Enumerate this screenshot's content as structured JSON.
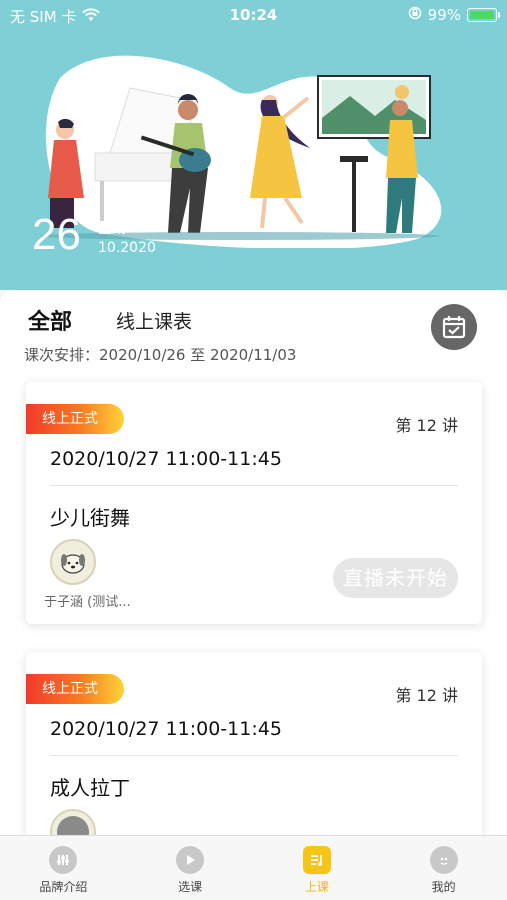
{
  "status_bar": {
    "carrier": "无 SIM 卡",
    "time": "10:24",
    "battery": "99%",
    "battery_level": 0.99
  },
  "banner": {
    "day": "26",
    "weekday": "星期一",
    "month_year": "10.2020"
  },
  "filter": {
    "tab_all": "全部",
    "tab_online": "线上课表",
    "schedule_text": "课次安排：2020/10/26 至 2020/11/03"
  },
  "courses": [
    {
      "badge": "线上正式",
      "lesson": "第 12 讲",
      "time": "2020/10/27 11:00-11:45",
      "title": "少儿街舞",
      "teacher": "于子涵 (测试...",
      "status": "直播未开始"
    },
    {
      "badge": "线上正式",
      "lesson": "第 12 讲",
      "time": "2020/10/27 11:00-11:45",
      "title": "成人拉丁"
    }
  ],
  "tabbar": {
    "items": [
      {
        "label": "品牌介绍",
        "icon": "brand-icon"
      },
      {
        "label": "选课",
        "icon": "play-icon"
      },
      {
        "label": "上课",
        "icon": "class-icon"
      },
      {
        "label": "我的",
        "icon": "profile-icon"
      }
    ],
    "active_color": "#f5b800"
  }
}
